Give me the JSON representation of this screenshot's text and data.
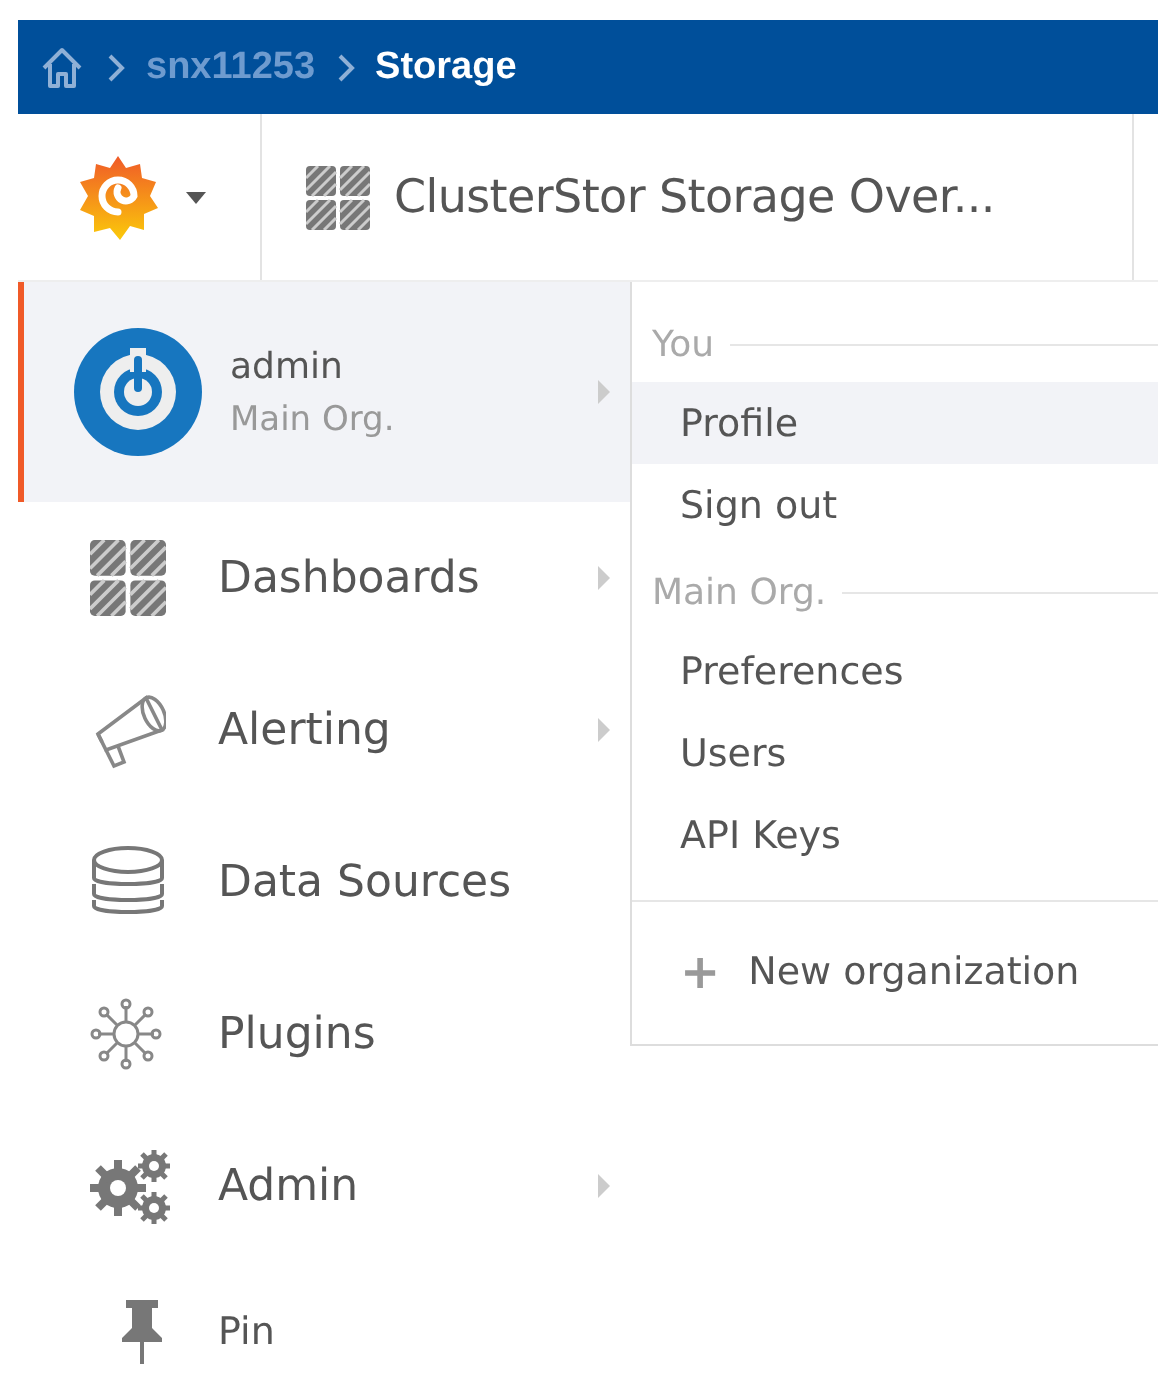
{
  "breadcrumb": {
    "items": [
      {
        "label": "snx11253",
        "current": false
      },
      {
        "label": "Storage",
        "current": true
      }
    ]
  },
  "header": {
    "dashboard_title": "ClusterStor Storage Over..."
  },
  "sidebar": {
    "user": {
      "name": "admin",
      "org": "Main Org.",
      "active": true,
      "has_submenu": true
    },
    "items": [
      {
        "label": "Dashboards",
        "kind": "grid",
        "has_submenu": true
      },
      {
        "label": "Alerting",
        "kind": "megaphone",
        "has_submenu": true
      },
      {
        "label": "Data Sources",
        "kind": "database",
        "has_submenu": false
      },
      {
        "label": "Plugins",
        "kind": "plugins",
        "has_submenu": false
      },
      {
        "label": "Admin",
        "kind": "gears",
        "has_submenu": true
      },
      {
        "label": "Pin",
        "kind": "pin",
        "has_submenu": false
      }
    ]
  },
  "user_menu": {
    "sections": [
      {
        "title": "You",
        "items": [
          {
            "label": "Profile",
            "selected": true
          },
          {
            "label": "Sign out",
            "selected": false
          }
        ]
      },
      {
        "title": "Main Org.",
        "items": [
          {
            "label": "Preferences",
            "selected": false
          },
          {
            "label": "Users",
            "selected": false
          },
          {
            "label": "API Keys",
            "selected": false
          }
        ]
      }
    ],
    "footer_action": {
      "icon": "+",
      "label": "New organization"
    }
  }
}
